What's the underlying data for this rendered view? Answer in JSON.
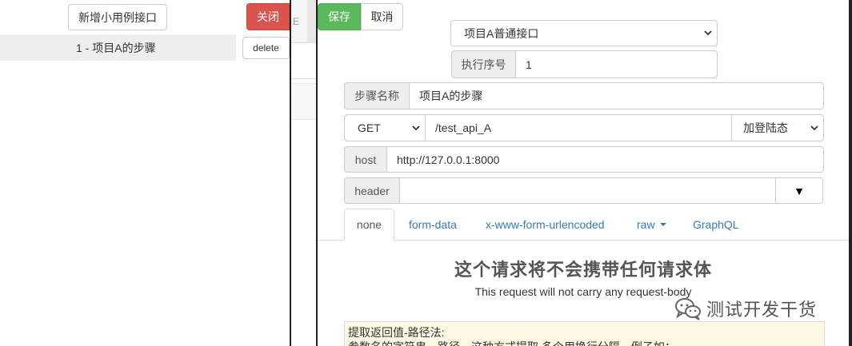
{
  "left_panel": {
    "add_button_label": "新增小用例接口",
    "close_button_label": "关闭",
    "step_item_label": "1 - 项目A的步骤",
    "delete_button_label": "delete"
  },
  "middle": {
    "glyph": "E"
  },
  "toolbar": {
    "save_label": "保存",
    "cancel_label": "取消"
  },
  "form": {
    "interface_select_value": "项目A普通接口",
    "order_label": "执行序号",
    "order_value": "1",
    "step_name_label": "步骤名称",
    "step_name_value": "项目A的步骤",
    "method_value": "GET",
    "path_value": "/test_api_A",
    "login_select_value": "加登陆态",
    "host_label": "host",
    "host_value": "http://127.0.0.1:8000",
    "header_label": "header",
    "header_value": "",
    "header_toggle_glyph": "▼"
  },
  "tabs": [
    {
      "label": "none"
    },
    {
      "label": "form-data"
    },
    {
      "label": "x-www-form-urlencoded"
    },
    {
      "label": "raw"
    },
    {
      "label": "GraphQL"
    }
  ],
  "body_empty": {
    "title": "这个请求将不会携带任何请求体",
    "subtitle": "This request will not carry any request-body"
  },
  "extract": {
    "line1": "提取返回值-路径法:",
    "line2": "参数名的字符串，路径，这种方式提取 多个用换行分隔，例子如："
  },
  "watermark": {
    "text": "测试开发干货"
  },
  "colors": {
    "save_green": "#5cb85c",
    "close_red": "#d9534f",
    "link_blue": "#337ab7",
    "extract_bg": "#fcf8e3"
  }
}
